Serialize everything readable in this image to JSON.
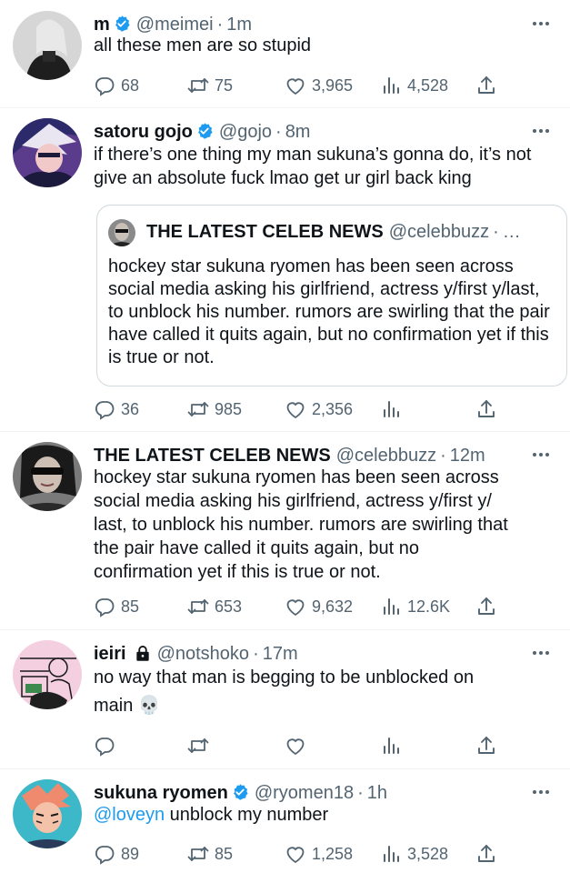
{
  "tweets": [
    {
      "name": "m",
      "verified": true,
      "handle": "@meimei",
      "time": "1m",
      "text": "all these men are so stupid",
      "replies": "68",
      "retweets": "75",
      "likes": "3,965",
      "views": "4,528"
    },
    {
      "name": "satoru gojo",
      "verified": true,
      "handle": "@gojo",
      "time": "8m",
      "text": "if there’s one thing my man sukuna’s gonna do, it’s not give an absolute fuck lmao get ur girl back king",
      "quote": {
        "name": "THE LATEST CELEB NEWS",
        "handle": "@celebbuzz",
        "time": "…",
        "text": "hockey star sukuna ryomen has been seen across social media asking his girlfriend, actress y/first y/last, to unblock his number.  rumors are swirling that the pair have called it quits again, but no confirmation yet if this is true or not."
      },
      "replies": "36",
      "retweets": "985",
      "likes": "2,356",
      "views": ""
    },
    {
      "name": "THE LATEST CELEB NEWS",
      "verified": false,
      "handle": "@celebbuzz",
      "time": "12m",
      "text": "hockey star sukuna ryomen has been seen across social media asking his girlfriend, actress y/first y/ last, to unblock his number.  rumors are swirling that the pair have called it quits again, but no confirmation yet if this is true or not.",
      "replies": "85",
      "retweets": "653",
      "likes": "9,632",
      "views": "12.6K"
    },
    {
      "name": "ieiri",
      "locked": true,
      "handle": "@notshoko",
      "time": "17m",
      "text": "no way that man is begging to be unblocked on main 💀",
      "replies": "",
      "retweets": "",
      "likes": "",
      "views": ""
    },
    {
      "name": "sukuna ryomen",
      "verified": true,
      "handle": "@ryomen18",
      "time": "1h",
      "mention": "@loveyn",
      "text": " unblock my number",
      "replies": "89",
      "retweets": "85",
      "likes": "1,258",
      "views": "3,528"
    }
  ],
  "colors": {
    "text": "#0f1419",
    "secondary": "#536471",
    "verified": "#1d9bf0",
    "mention": "#1d9bf0",
    "divider": "#eff3f4"
  },
  "icons": [
    "reply-icon",
    "retweet-icon",
    "like-icon",
    "views-icon",
    "share-icon",
    "more-icon",
    "verified-badge-icon",
    "lock-icon"
  ]
}
